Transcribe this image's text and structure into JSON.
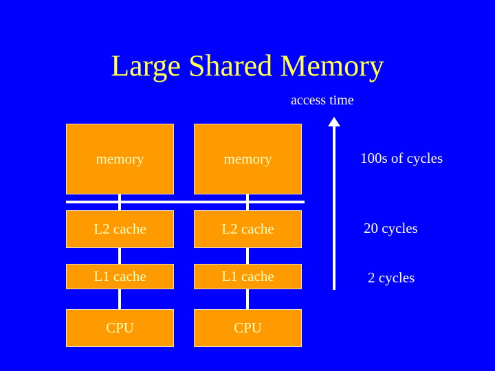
{
  "slide": {
    "title": "Large Shared Memory",
    "axis_label": "access time",
    "columns": [
      {
        "memory": "memory",
        "l2": "L2 cache",
        "l1": "L1 cache",
        "cpu": "CPU"
      },
      {
        "memory": "memory",
        "l2": "L2 cache",
        "l1": "L1 cache",
        "cpu": "CPU"
      }
    ],
    "latencies": {
      "memory": "100s of cycles",
      "l2": "20 cycles",
      "l1": "2 cycles"
    },
    "colors": {
      "background": "#0000fe",
      "box_fill": "#ff9a00",
      "title": "#ffff4c",
      "text": "#ffffff"
    }
  }
}
